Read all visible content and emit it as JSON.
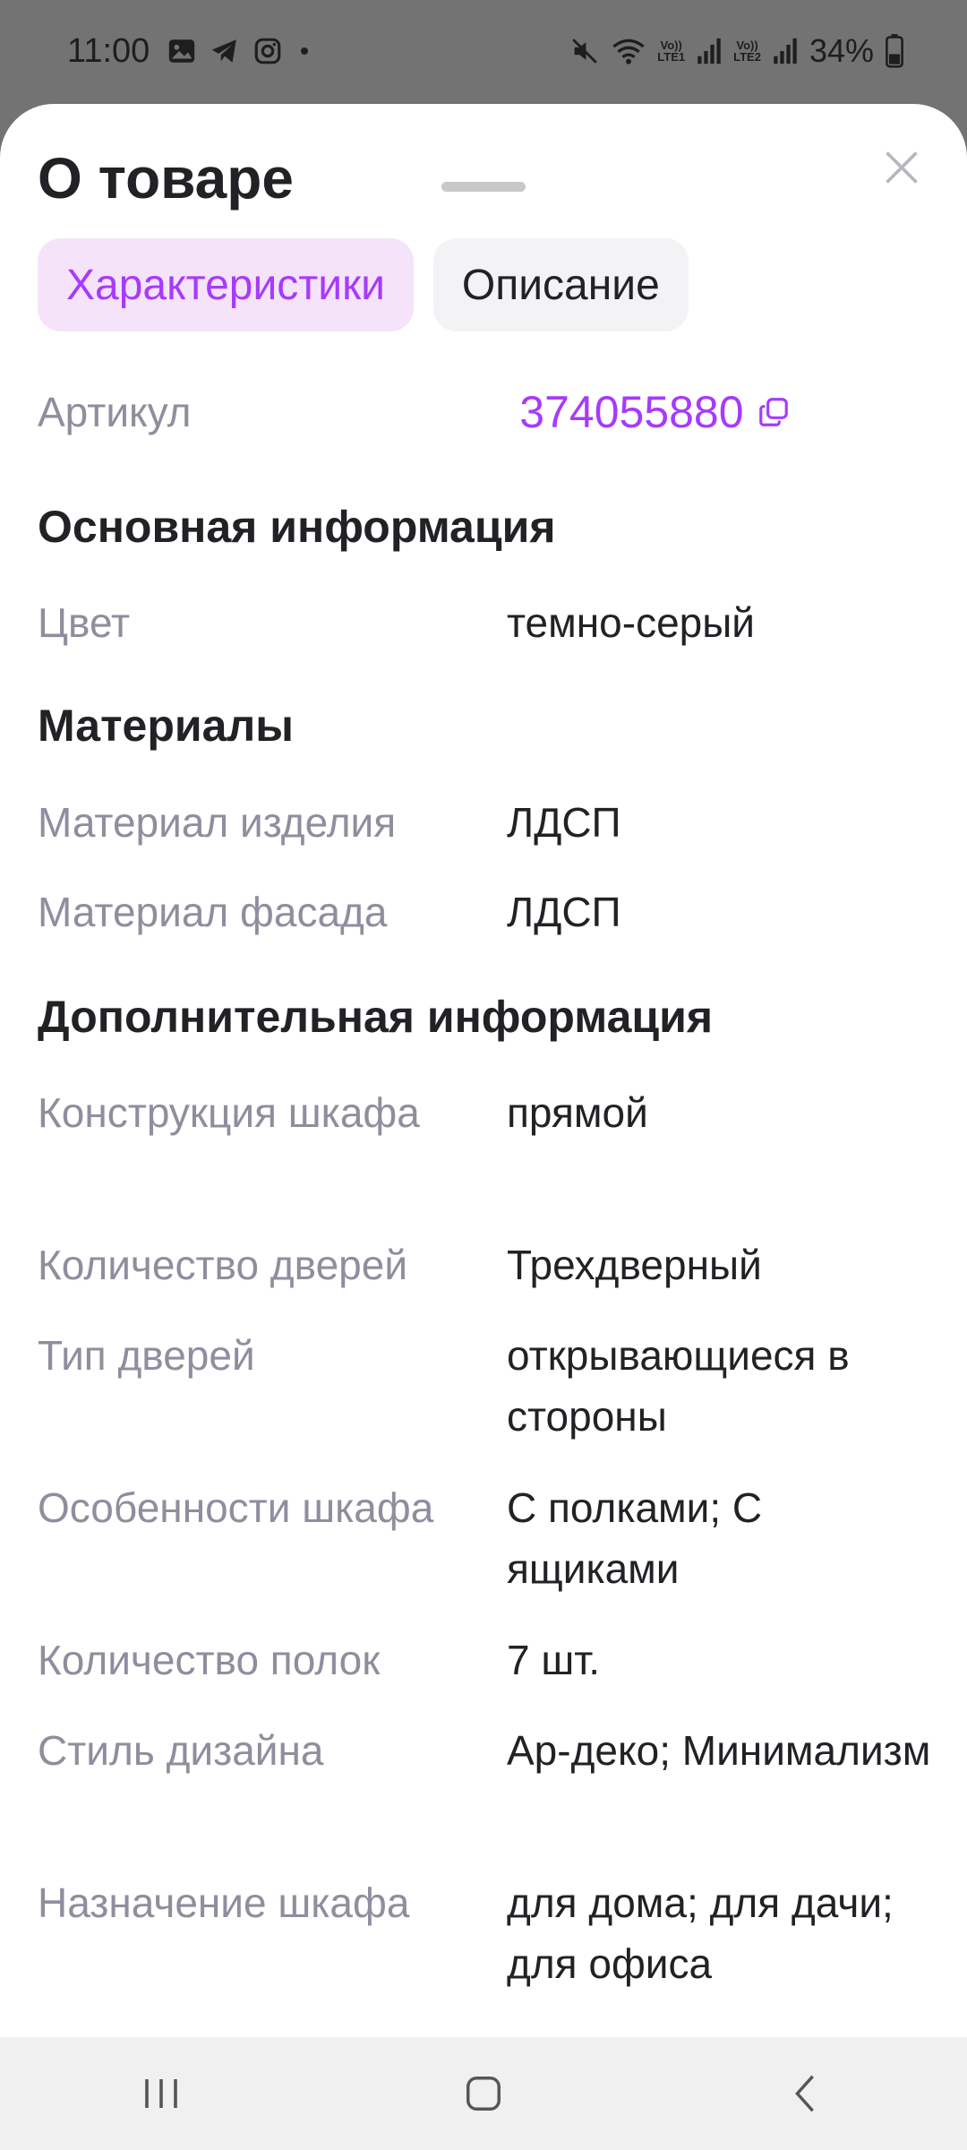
{
  "status_bar": {
    "time": "11:00",
    "battery": "34%",
    "sim1": "LTE1",
    "sim2": "LTE2",
    "volte": "Vo))"
  },
  "sheet": {
    "title": "О товаре",
    "tabs": [
      {
        "label": "Характеристики",
        "active": true
      },
      {
        "label": "Описание",
        "active": false
      }
    ],
    "article": {
      "label": "Артикул",
      "value": "374055880"
    },
    "sections": [
      {
        "title": "Основная информация",
        "rows": [
          {
            "label": "Цвет",
            "value": "темно-серый"
          }
        ]
      },
      {
        "title": "Материалы",
        "rows": [
          {
            "label": "Материал изделия",
            "value": "ЛДСП"
          },
          {
            "label": "Материал фасада",
            "value": "ЛДСП"
          }
        ]
      },
      {
        "title": "Дополнительная информация",
        "rows": [
          {
            "label": "Конструкция шкафа",
            "value": "прямой"
          },
          {
            "label": "Количество дверей",
            "value": "Трехдверный"
          },
          {
            "label": "Тип дверей",
            "value": "открывающиеся в стороны"
          },
          {
            "label": "Особенности шкафа",
            "value": "С полками; С ящиками"
          },
          {
            "label": "Количество полок",
            "value": "7 шт."
          },
          {
            "label": "Стиль дизайна",
            "value": "Ар-деко; Минимализм"
          },
          {
            "label": "Назначение шкафа",
            "value": "для дома; для дачи; для офиса"
          }
        ]
      }
    ]
  },
  "colors": {
    "accent": "#a73afd",
    "accent_bg": "#f5e3fa",
    "label": "#8e8e9e",
    "text": "#222226"
  }
}
